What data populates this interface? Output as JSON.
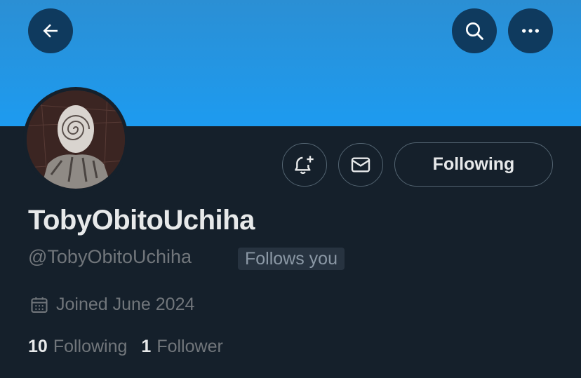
{
  "header": {
    "back_icon": "arrow-left-icon",
    "search_icon": "search-icon",
    "more_icon": "more-horizontal-icon",
    "banner_color": "#1d9bf0"
  },
  "actions": {
    "notify_icon": "bell-plus-icon",
    "message_icon": "mail-icon",
    "follow_label": "Following"
  },
  "profile": {
    "display_name": "TobyObitoUchiha",
    "handle": "@TobyObitoUchiha",
    "follows_you": "Follows you",
    "joined_icon": "calendar-icon",
    "joined": "Joined June 2024"
  },
  "stats": {
    "following_count": "10",
    "following_label": "Following",
    "followers_count": "1",
    "followers_label": "Follower"
  }
}
